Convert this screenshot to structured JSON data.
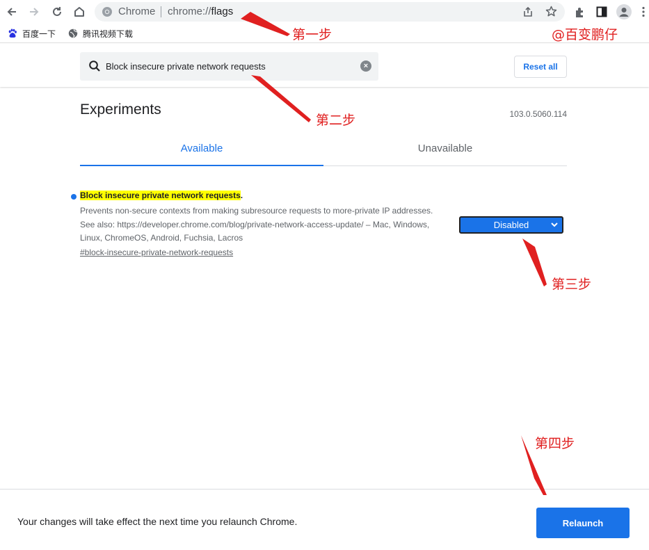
{
  "browser": {
    "site_label": "Chrome",
    "url_scheme": "chrome://",
    "url_path": "flags"
  },
  "bookmarks": [
    {
      "label": "百度一下",
      "icon": "baidu-paw-icon"
    },
    {
      "label": "腾讯视频下载",
      "icon": "globe-icon"
    }
  ],
  "header": {
    "search_value": "Block insecure private network requests",
    "reset_label": "Reset all"
  },
  "main": {
    "title": "Experiments",
    "version": "103.0.5060.114",
    "tabs": [
      {
        "label": "Available",
        "active": true
      },
      {
        "label": "Unavailable",
        "active": false
      }
    ],
    "experiment": {
      "title": "Block insecure private network requests",
      "title_suffix": ".",
      "description": "Prevents non-secure contexts from making subresource requests to more-private IP addresses. See also: https://developer.chrome.com/blog/private-network-access-update/ – Mac, Windows, Linux, ChromeOS, Android, Fuchsia, Lacros",
      "link": "#block-insecure-private-network-requests",
      "selected_option": "Disabled"
    }
  },
  "relaunch": {
    "message": "Your changes will take effect the next time you relaunch Chrome.",
    "button_label": "Relaunch"
  },
  "annotations": {
    "step1": "第一步",
    "step2": "第二步",
    "step3": "第三步",
    "step4": "第四步",
    "watermark": "@百变鹏仔",
    "color": "#e02020"
  },
  "colors": {
    "accent": "#1a73e8",
    "highlight": "#ffff00"
  }
}
